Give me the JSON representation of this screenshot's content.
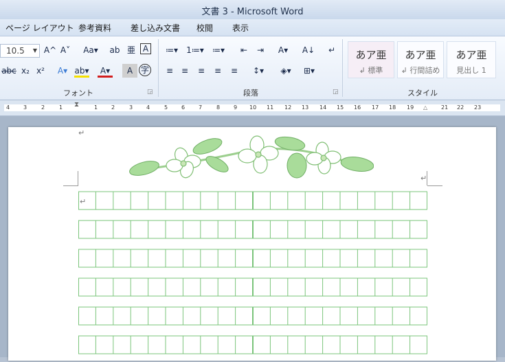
{
  "title": "文書 3 - Microsoft Word",
  "menu": [
    "ページ レイアウト",
    "参考資料",
    "差し込み文書",
    "校閲",
    "表示"
  ],
  "ribbon": {
    "font_size": "10.5",
    "groups": {
      "font": "フォント",
      "paragraph": "段落",
      "style": "スタイル"
    },
    "styles": [
      {
        "sample": "あア亜",
        "name": "↲ 標準"
      },
      {
        "sample": "あア亜",
        "name": "↲ 行間詰め"
      },
      {
        "sample": "あア亜",
        "name": "見出し 1"
      }
    ],
    "font_buttons": [
      "A^",
      "A˅",
      "Aa▾",
      "ab",
      "亜",
      "A",
      "abc",
      "x₂",
      "x²",
      "A▾",
      "ab▾",
      "A▾",
      "A",
      "字"
    ],
    "paragraph_buttons": [
      "≔▾",
      "1≔▾",
      "≔▾",
      "⇤",
      "⇥",
      "A▾",
      "A↓",
      "↵",
      "≡",
      "≡",
      "≡",
      "≡",
      "≡",
      "↕▾",
      "◈▾",
      "⊞▾"
    ]
  },
  "ruler": {
    "labels": [
      "4",
      "3",
      "2",
      "1",
      "1",
      "2",
      "3",
      "4",
      "5",
      "6",
      "7",
      "8",
      "9",
      "10",
      "11",
      "12",
      "13",
      "14",
      "15",
      "16",
      "17",
      "18",
      "19",
      "21",
      "22",
      "23"
    ]
  },
  "document": {
    "paragraph_mark": "↵",
    "grid": {
      "rows": 6,
      "cols": 20,
      "color": "#7ac47a"
    }
  }
}
